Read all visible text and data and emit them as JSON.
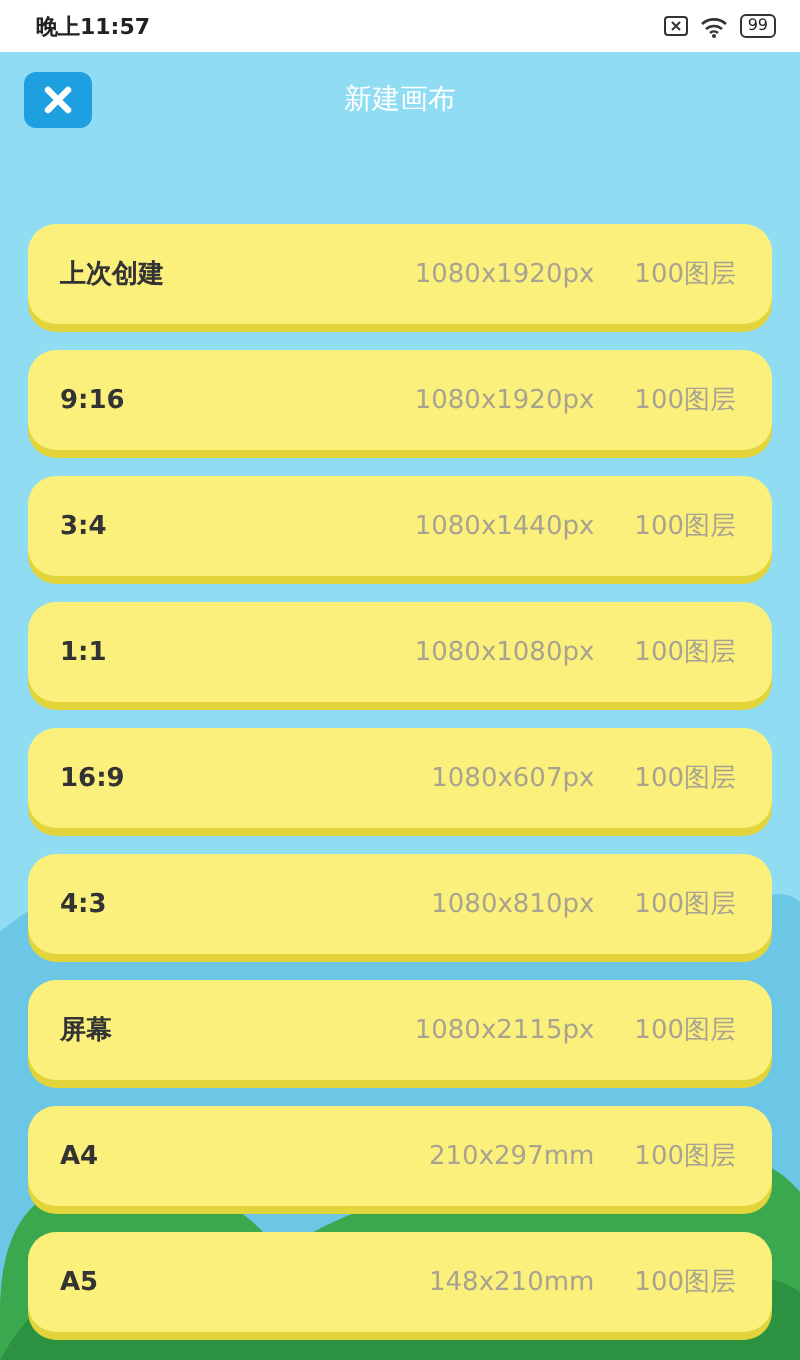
{
  "status_bar": {
    "time": "晚上11:57",
    "battery": "99"
  },
  "header": {
    "title": "新建画布"
  },
  "presets": [
    {
      "name": "上次创建",
      "size": "1080x1920px",
      "layers": "100图层"
    },
    {
      "name": "9:16",
      "size": "1080x1920px",
      "layers": "100图层"
    },
    {
      "name": "3:4",
      "size": "1080x1440px",
      "layers": "100图层"
    },
    {
      "name": "1:1",
      "size": "1080x1080px",
      "layers": "100图层"
    },
    {
      "name": "16:9",
      "size": "1080x607px",
      "layers": "100图层"
    },
    {
      "name": "4:3",
      "size": "1080x810px",
      "layers": "100图层"
    },
    {
      "name": "屏幕",
      "size": "1080x2115px",
      "layers": "100图层"
    },
    {
      "name": "A4",
      "size": "210x297mm",
      "layers": "100图层"
    },
    {
      "name": "A5",
      "size": "148x210mm",
      "layers": "100图层"
    }
  ]
}
